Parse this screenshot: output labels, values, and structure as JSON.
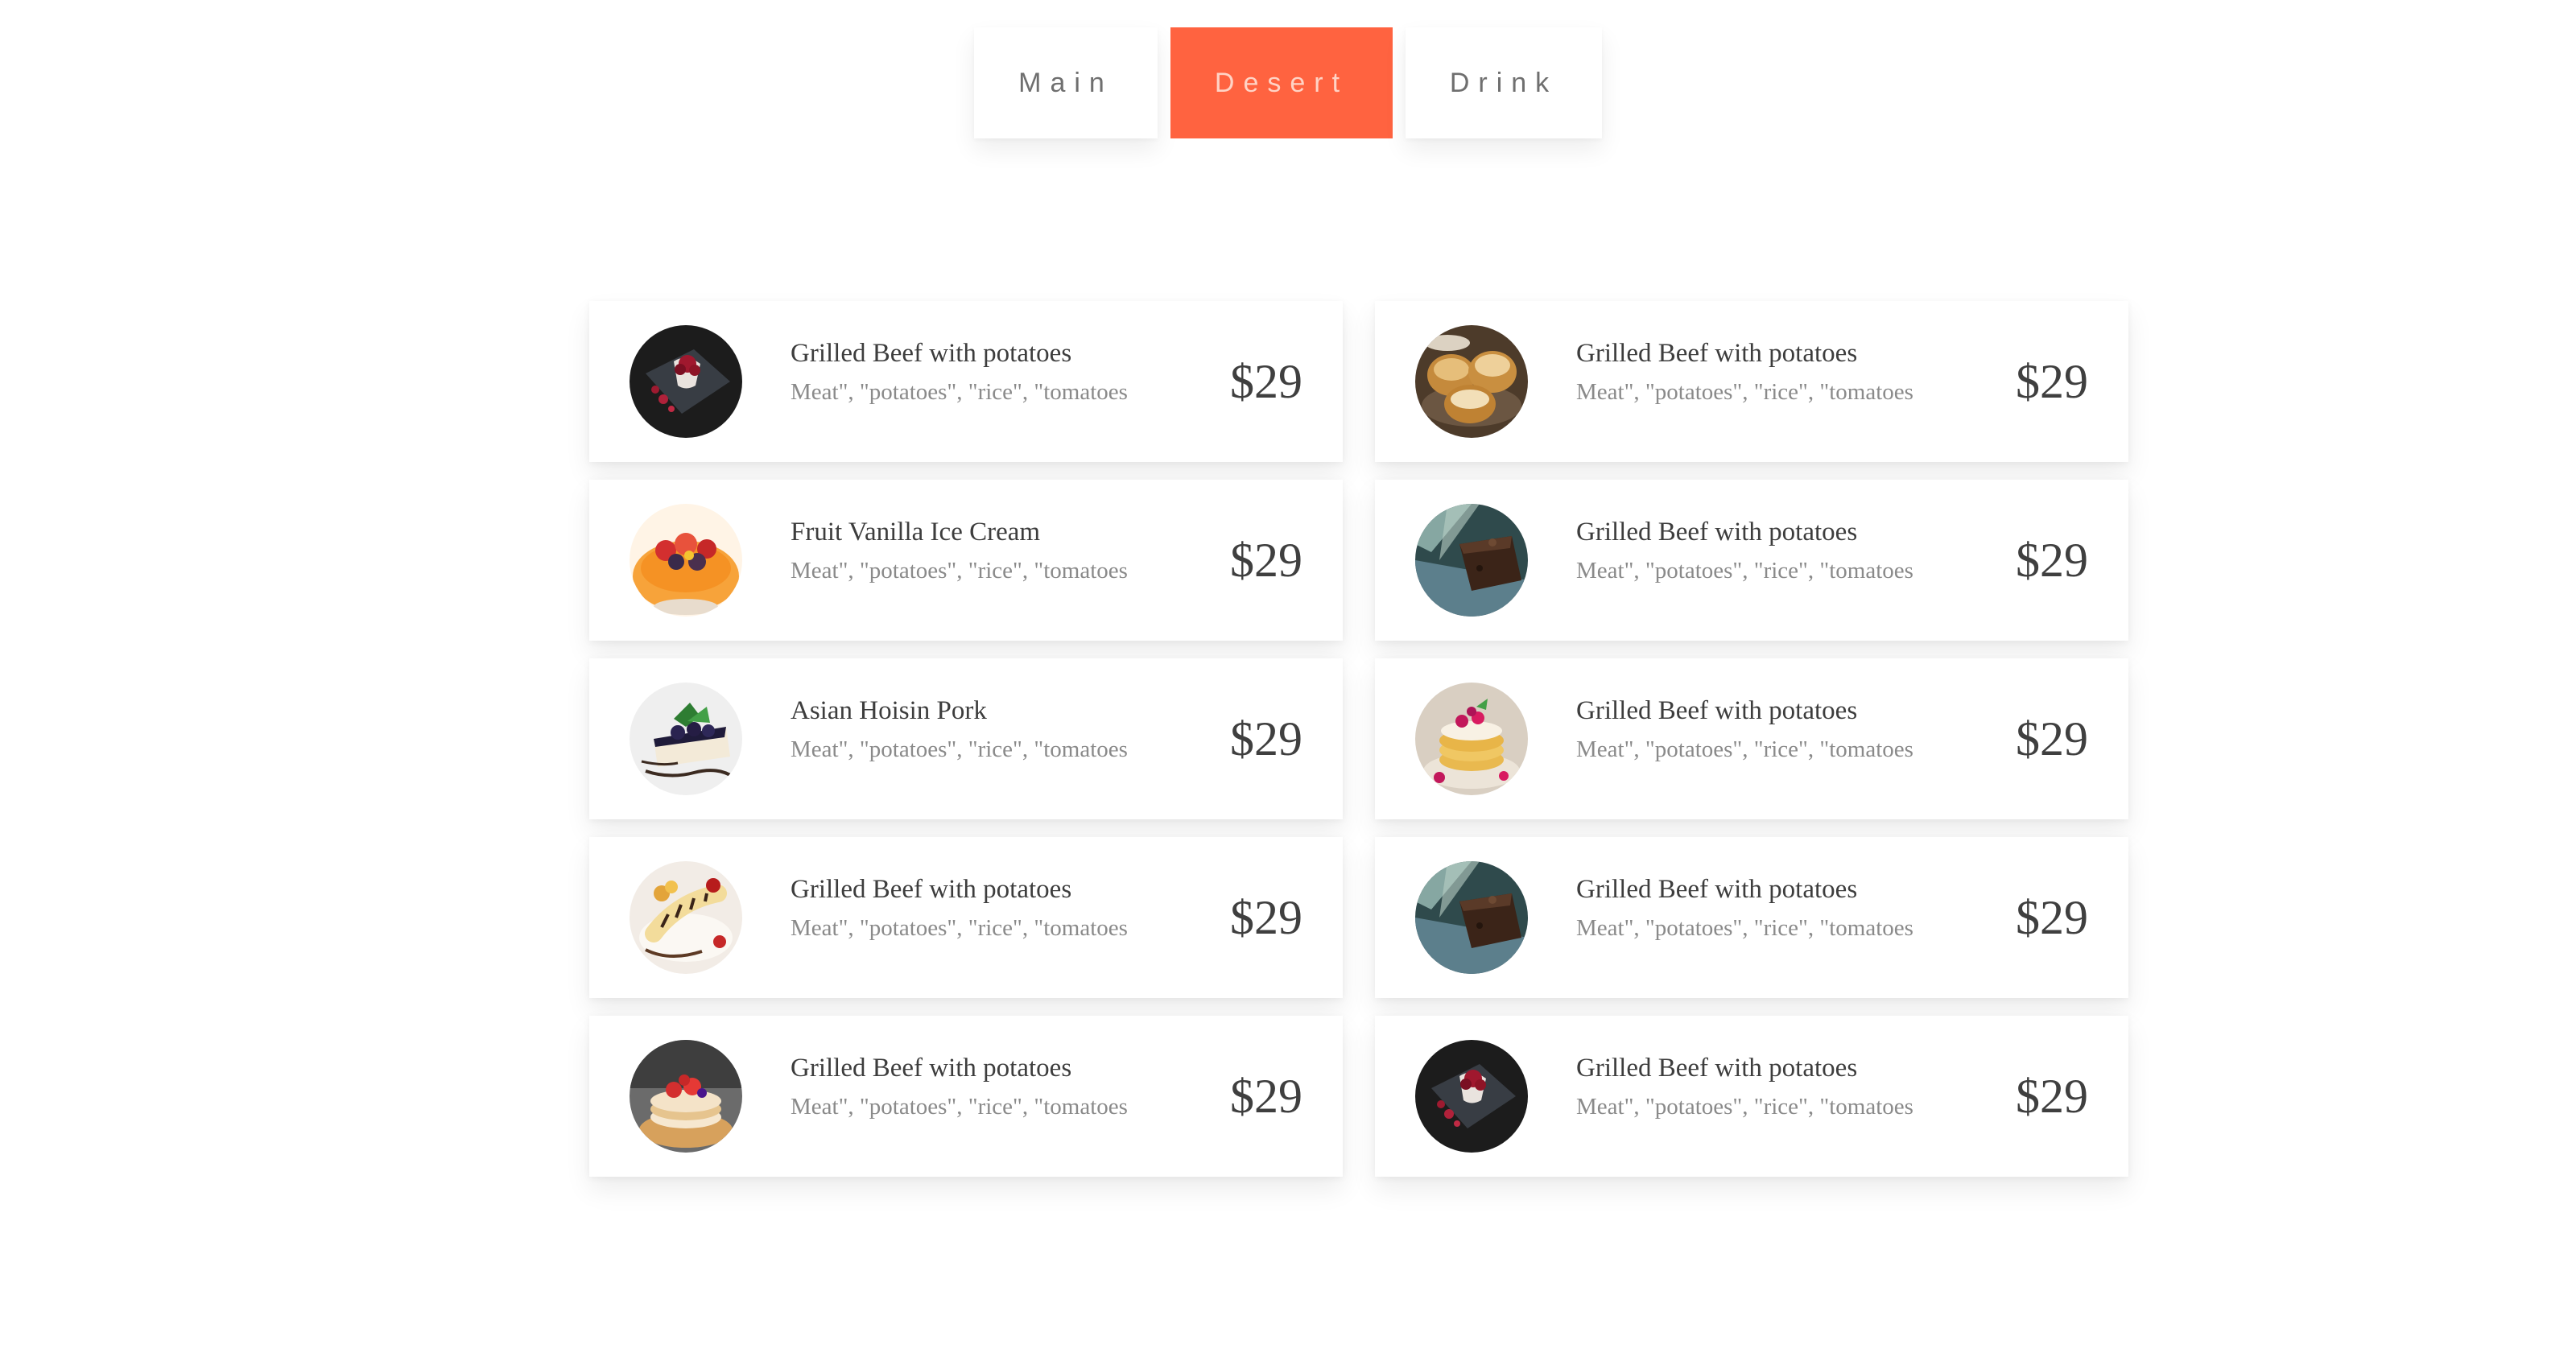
{
  "tabs": [
    {
      "label": "Main",
      "active": false
    },
    {
      "label": "Desert",
      "active": true
    },
    {
      "label": "Drink",
      "active": false
    }
  ],
  "accent_color": "#ff6340",
  "menu": {
    "items": [
      {
        "name": "Grilled Beef with potatoes",
        "desc": "Meat\", \"potatoes\", \"rice\", \"tomatoes",
        "price": "$29",
        "image": "berry-parfait-dark-photo"
      },
      {
        "name": "Grilled Beef with potatoes",
        "desc": "Meat\", \"potatoes\", \"rice\", \"tomatoes",
        "price": "$29",
        "image": "cream-puffs-photo"
      },
      {
        "name": "Fruit Vanilla Ice Cream",
        "desc": "Meat\", \"potatoes\", \"rice\", \"tomatoes",
        "price": "$29",
        "image": "fruit-tart-photo"
      },
      {
        "name": "Grilled Beef with potatoes",
        "desc": "Meat\", \"potatoes\", \"rice\", \"tomatoes",
        "price": "$29",
        "image": "chocolate-brownie-photo"
      },
      {
        "name": "Asian Hoisin Pork",
        "desc": "Meat\", \"potatoes\", \"rice\", \"tomatoes",
        "price": "$29",
        "image": "blueberry-cheesecake-photo"
      },
      {
        "name": "Grilled Beef with potatoes",
        "desc": "Meat\", \"potatoes\", \"rice\", \"tomatoes",
        "price": "$29",
        "image": "pancakes-raspberry-photo"
      },
      {
        "name": "Grilled Beef with potatoes",
        "desc": "Meat\", \"potatoes\", \"rice\", \"tomatoes",
        "price": "$29",
        "image": "banana-dessert-photo"
      },
      {
        "name": "Grilled Beef with potatoes",
        "desc": "Meat\", \"potatoes\", \"rice\", \"tomatoes",
        "price": "$29",
        "image": "chocolate-brownie-photo"
      },
      {
        "name": "Grilled Beef with potatoes",
        "desc": "Meat\", \"potatoes\", \"rice\", \"tomatoes",
        "price": "$29",
        "image": "strawberry-pancakes-photo"
      },
      {
        "name": "Grilled Beef with potatoes",
        "desc": "Meat\", \"potatoes\", \"rice\", \"tomatoes",
        "price": "$29",
        "image": "berry-parfait-dark-photo"
      }
    ]
  }
}
